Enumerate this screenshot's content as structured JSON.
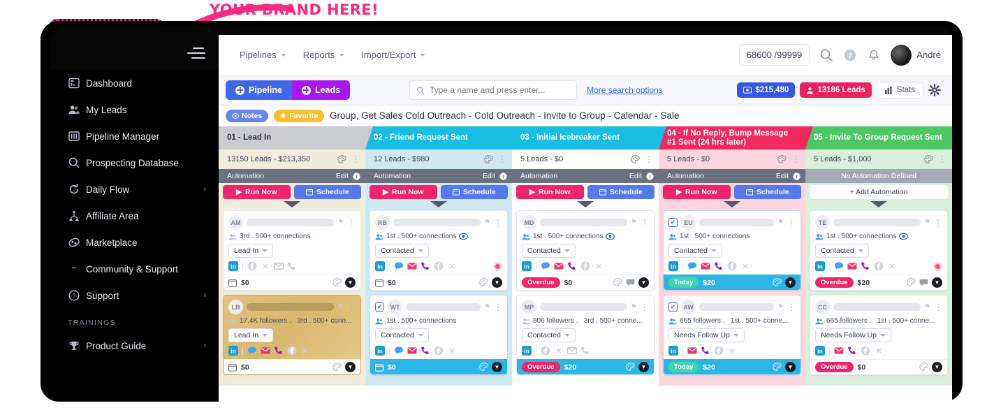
{
  "callout": {
    "text": "YOUR BRAND HERE!",
    "color": "#fa2a7f"
  },
  "sidebar": {
    "items": [
      {
        "label": "Dashboard",
        "icon": "dashboard-icon",
        "chevron": ""
      },
      {
        "label": "My Leads",
        "icon": "people-icon",
        "chevron": ""
      },
      {
        "label": "Pipeline Manager",
        "icon": "columns-icon",
        "chevron": ""
      },
      {
        "label": "Prospecting Database",
        "icon": "search-icon",
        "chevron": ""
      },
      {
        "label": "Daily Flow",
        "icon": "refresh-icon",
        "chevron": "›"
      },
      {
        "label": "Affiliate Area",
        "icon": "affiliate-icon",
        "chevron": ""
      },
      {
        "label": "Marketplace",
        "icon": "marketplace-icon",
        "chevron": ""
      },
      {
        "label": "Community & Support",
        "icon": "chat-icon",
        "chevron": ""
      },
      {
        "label": "Support",
        "icon": "question-circle-icon",
        "chevron": "›"
      }
    ],
    "section_label": "TRAININGS",
    "trainings": [
      {
        "label": "Product Guide",
        "icon": "trophy-icon",
        "chevron": "›"
      }
    ]
  },
  "header": {
    "nav": [
      {
        "label": "Pipelines"
      },
      {
        "label": "Reports"
      },
      {
        "label": "Import/Export"
      }
    ],
    "quota": "68600 /99999",
    "search_icon": "search-icon",
    "help_icon": "question-circle-icon",
    "bell_icon": "bell-icon",
    "user_name": "André"
  },
  "toolbar": {
    "pipeline_label": "Pipeline",
    "leads_label": "Leads",
    "search_placeholder": "Type a name and press enter...",
    "more_search": "More search options",
    "revenue_pill": "$215,480",
    "leads_pill": "13186 Leads",
    "stats_label": "Stats",
    "gear_icon": "gear-icon",
    "colors": {
      "pipeline": "#4067e8",
      "leads": "#a718f0",
      "revenue": "#3457e8",
      "leads_pill": "#ef2060"
    }
  },
  "notes_row": {
    "notes_label": "Notes",
    "favorite_label": "Favorite",
    "breadcrumb": "Group, Get Sales Cold Outreach - Cold Outreach - Invite to Group - Calendar - Sale"
  },
  "board": {
    "automation_label": "Automation",
    "edit_label": "Edit",
    "no_automation_label": "No Automation Defined",
    "run_now_label": "Run Now",
    "schedule_label": "Schedule",
    "add_automation_label": "+ Add Automation",
    "columns": [
      {
        "title": "01 - Lead In",
        "stats": "13150 Leads - $213,350",
        "head_bg": "#cbcccf",
        "head_color": "#2b2f3d",
        "body_bg": "#f0eddc",
        "has_automation": true,
        "cards": [
          {
            "initials": "AM",
            "checked": false,
            "meta": "3rd . 500+ connections",
            "meta_people": "gray",
            "status": "Lead In",
            "socials": [
              "in",
              "fb",
              "x",
              "mail",
              "phone"
            ],
            "socials_active": [
              "in"
            ],
            "badge": "",
            "amount": "$0",
            "foot": "white",
            "gold": false,
            "eye": false,
            "dot": false,
            "comment": false,
            "calendar": true
          },
          {
            "initials": "LB",
            "checked": false,
            "meta": "17.4K followers .   3rd . 500+ conn...",
            "meta_people": "gray",
            "status": "Lead In",
            "socials": [
              "in",
              "chat",
              "mail",
              "phone",
              "fb",
              "x"
            ],
            "socials_active": [
              "in",
              "chat",
              "mail",
              "phone"
            ],
            "badge": "",
            "amount": "$0",
            "foot": "white",
            "gold": true,
            "eye": false,
            "dot": false,
            "comment": false,
            "calendar": true
          }
        ]
      },
      {
        "title": "02 - Friend Request Sent",
        "stats": "12 Leads - $980",
        "head_bg": "#18bde3",
        "head_color": "#ffffff",
        "body_bg": "#cfe9f3",
        "has_automation": true,
        "cards": [
          {
            "initials": "RB",
            "checked": false,
            "meta": "1st . 500+ connections",
            "meta_people": "blue",
            "status": "Contacted",
            "socials": [
              "in",
              "chat",
              "mail",
              "phone",
              "fb",
              "x"
            ],
            "socials_active": [
              "in",
              "chat",
              "mail",
              "phone"
            ],
            "badge": "",
            "amount": "$0",
            "foot": "white",
            "gold": false,
            "eye": true,
            "dot": true,
            "comment": false,
            "calendar": true
          },
          {
            "initials": "WT",
            "checked": true,
            "meta": "1st . 500+ connections",
            "meta_people": "blue",
            "status": "Contacted",
            "socials": [
              "in",
              "chat",
              "mail",
              "phone",
              "fb",
              "x"
            ],
            "socials_active": [
              "in",
              "chat",
              "mail",
              "phone"
            ],
            "badge": "",
            "amount": "$0",
            "foot": "cyan",
            "gold": false,
            "eye": false,
            "dot": false,
            "comment": false,
            "calendar": true
          }
        ]
      },
      {
        "title": "03 - Initial Icebreaker Sent",
        "stats": "5 Leads - $0",
        "head_bg": "#18bde3",
        "head_color": "#ffffff",
        "body_bg": "#ffffff",
        "has_automation": true,
        "cards": [
          {
            "initials": "MD",
            "checked": false,
            "meta": "1st . 500+ connections",
            "meta_people": "blue",
            "status": "Contacted",
            "socials": [
              "in",
              "chat",
              "mail",
              "phone",
              "fb",
              "x"
            ],
            "socials_active": [
              "in",
              "chat",
              "mail",
              "phone"
            ],
            "badge": "Overdue",
            "amount": "$0",
            "foot": "white",
            "gold": false,
            "eye": true,
            "dot": false,
            "comment": true,
            "calendar": false
          },
          {
            "initials": "MP",
            "checked": false,
            "meta": "806 followers .   3rd . 500+ conne...",
            "meta_people": "gray",
            "status": "Contacted",
            "socials": [
              "in",
              "fb",
              "x",
              "mail",
              "phone"
            ],
            "socials_active": [
              "in"
            ],
            "badge": "Overdue",
            "amount": "$20",
            "foot": "cyan",
            "gold": false,
            "eye": false,
            "dot": false,
            "comment": false,
            "calendar": false
          }
        ]
      },
      {
        "title": "04 - If No Reply, Bump Message #1 Sent (24 hrs later)",
        "stats": "5 Leads - $0",
        "head_bg": "#f0295f",
        "head_color": "#ffffff",
        "body_bg": "#fbd6de",
        "has_automation": true,
        "cards": [
          {
            "initials": "EU",
            "checked": true,
            "meta": "1st . 500+ connections",
            "meta_people": "blue",
            "status": "Contacted",
            "socials": [
              "in",
              "chat",
              "mail",
              "phone",
              "fb",
              "x"
            ],
            "socials_active": [
              "in",
              "chat",
              "mail",
              "phone"
            ],
            "badge": "Today",
            "amount": "$20",
            "foot": "cyan",
            "gold": false,
            "eye": false,
            "dot": false,
            "comment": false,
            "calendar": false
          },
          {
            "initials": "AW",
            "checked": true,
            "meta": "665 followers .   1st . 500+ conne...",
            "meta_people": "blue",
            "status": "Needs Follow Up",
            "socials": [
              "in",
              "mail",
              "phone",
              "fb",
              "x"
            ],
            "socials_active": [
              "in",
              "mail",
              "phone"
            ],
            "badge": "Today",
            "amount": "$20",
            "foot": "cyan",
            "gold": false,
            "eye": false,
            "dot": false,
            "comment": false,
            "calendar": false
          }
        ]
      },
      {
        "title": "05 - Invite To Group Request Sent",
        "stats": "5 Leads - $1,000",
        "head_bg": "#4cc764",
        "head_color": "#ffffff",
        "body_bg": "#d9eedd",
        "has_automation": false,
        "cards": [
          {
            "initials": "TE",
            "checked": false,
            "meta": "1st . 500+ connections",
            "meta_people": "blue",
            "status": "Contacted",
            "socials": [
              "in",
              "chat",
              "mail",
              "phone",
              "fb",
              "x"
            ],
            "socials_active": [
              "in",
              "chat",
              "mail",
              "phone"
            ],
            "badge": "Overdue",
            "amount": "$20",
            "foot": "white",
            "gold": false,
            "eye": true,
            "dot": true,
            "comment": true,
            "calendar": false
          },
          {
            "initials": "CC",
            "checked": false,
            "meta": "665 followers .   1st . 500+ conne...",
            "meta_people": "blue",
            "status": "Needs Follow Up",
            "socials": [
              "in",
              "mail",
              "phone",
              "fb",
              "x"
            ],
            "socials_active": [
              "in",
              "mail",
              "phone"
            ],
            "badge": "Overdue",
            "amount": "$0",
            "foot": "white",
            "gold": false,
            "eye": false,
            "dot": false,
            "comment": false,
            "calendar": false
          }
        ]
      }
    ]
  }
}
